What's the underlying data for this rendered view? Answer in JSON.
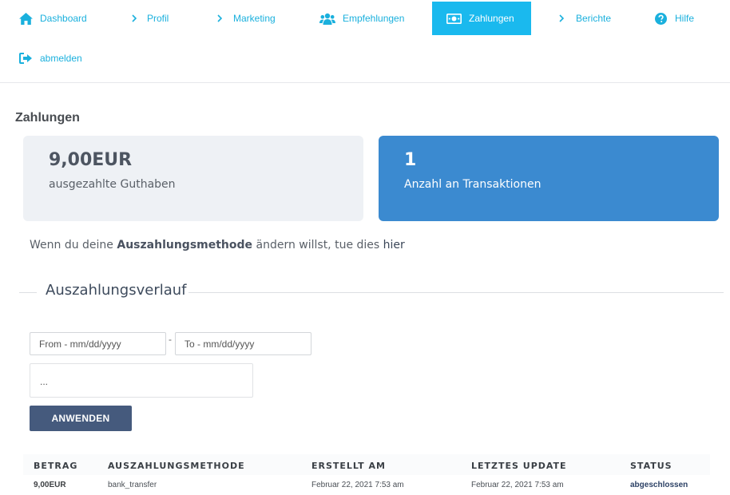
{
  "nav": {
    "items": [
      {
        "label": "Dashboard",
        "icon": "home-icon"
      },
      {
        "label": "Profil",
        "icon": "chevron-right-icon"
      },
      {
        "label": "Marketing",
        "icon": "chevron-right-icon"
      },
      {
        "label": "Empfehlungen",
        "icon": "users-icon"
      },
      {
        "label": "Zahlungen",
        "icon": "money-icon",
        "active": true
      },
      {
        "label": "Berichte",
        "icon": "chevron-right-icon"
      },
      {
        "label": "Hilfe",
        "icon": "help-icon"
      },
      {
        "label": "abmelden",
        "icon": "logout-icon"
      }
    ]
  },
  "page": {
    "title": "Zahlungen"
  },
  "cards": {
    "balance": {
      "value": "9,00EUR",
      "label": "ausgezahlte Guthaben"
    },
    "transactions": {
      "value": "1",
      "label": "Anzahl an Transaktionen"
    }
  },
  "info": {
    "prefix": "Wenn du deine ",
    "bold": "Auszahlungsmethode",
    "middle": " ändern willst, tue dies ",
    "link": "hier"
  },
  "history": {
    "title": "Auszahlungsverlauf",
    "from_placeholder": "From - mm/dd/yyyy",
    "to_placeholder": "To - mm/dd/yyyy",
    "separator": "-",
    "select_value": "...",
    "apply_label": "ANWENDEN"
  },
  "table": {
    "headers": [
      "BETRAG",
      "AUSZAHLUNGSMETHODE",
      "ERSTELLT AM",
      "LETZTES UPDATE",
      "STATUS"
    ],
    "rows": [
      [
        "9,00EUR",
        "bank_transfer",
        "Februar 22, 2021 7:53 am",
        "Februar 22, 2021 7:53 am",
        "abgeschlossen"
      ]
    ]
  },
  "colors": {
    "accent": "#1ab0dd",
    "active_nav": "#1ab9ee",
    "transactions_card": "#3b8ad0",
    "balance_card": "#eef1f5",
    "button": "#455a7d"
  }
}
